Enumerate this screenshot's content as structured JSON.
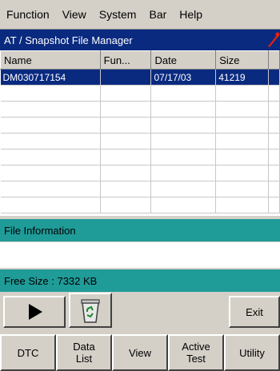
{
  "menu": [
    "Function",
    "View",
    "System",
    "Bar",
    "Help"
  ],
  "window": {
    "title": "AT / Snapshot File Manager"
  },
  "table": {
    "columns": [
      "Name",
      "Fun...",
      "Date",
      "Size"
    ],
    "rows": [
      {
        "name": "DM030717154",
        "fun": "",
        "date": "07/17/03",
        "size": "41219"
      }
    ]
  },
  "file_info": {
    "label": "File Information"
  },
  "free_size": {
    "label": "Free Size : 7332 KB"
  },
  "buttons": {
    "play": "play-icon",
    "recycle": "recycle-bin-icon",
    "exit": "Exit"
  },
  "tabs": [
    {
      "label": "DTC"
    },
    {
      "label": "Data\nList"
    },
    {
      "label": "View"
    },
    {
      "label": "Active\nTest"
    },
    {
      "label": "Utility"
    }
  ],
  "colors": {
    "titlebar": "#0a2a80",
    "section": "#1f9b98",
    "selection": "#0a2a80",
    "chrome": "#d4d0c8"
  }
}
